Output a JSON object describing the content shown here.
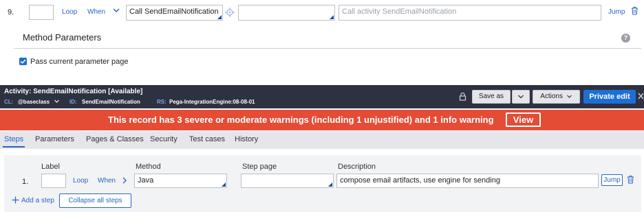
{
  "top_row": {
    "step_number": "9.",
    "loop_label": "Loop",
    "when_label": "When",
    "method_value": "Call SendEmailNotification",
    "step_page_value": "",
    "description_placeholder": "Call activity SendEmailNotification",
    "jump_label": "Jump"
  },
  "method_parameters": {
    "title": "Method Parameters",
    "pass_page_label": "Pass current parameter page",
    "pass_page_checked": true,
    "help_glyph": "?"
  },
  "header": {
    "title": "Activity: SendEmailNotification [Available]",
    "cl_label": "CL:",
    "cl_value": "@baseclass",
    "id_label": "ID:",
    "id_value": "SendEmailNotification",
    "rs_label": "RS:",
    "rs_value": "Pega-IntegrationEngine:08-08-01",
    "save_as_label": "Save as",
    "actions_label": "Actions",
    "private_edit_label": "Private edit"
  },
  "warning": {
    "text": "This record has 3 severe or moderate warnings (including 1 unjustified) and 1 info warning",
    "view_label": "View",
    "color": "#e54c35"
  },
  "tabs": [
    {
      "label": "Steps"
    },
    {
      "label": "Parameters"
    },
    {
      "label": "Pages & Classes"
    },
    {
      "label": "Security"
    },
    {
      "label": "Test cases"
    },
    {
      "label": "History"
    }
  ],
  "steps_table": {
    "headers": {
      "label": "Label",
      "method": "Method",
      "step_page": "Step page",
      "description": "Description"
    },
    "row": {
      "number": "1.",
      "label_value": "",
      "loop_label": "Loop",
      "when_label": "When",
      "method_value": "Java",
      "step_page_value": "",
      "description_value": "compose email artifacts, use engine for sending",
      "jump_label": "Jump"
    },
    "add_step_label": "Add a step",
    "collapse_label": "Collapse all steps"
  },
  "colors": {
    "accent": "#2a64c5",
    "dark_header": "#2d3140",
    "primary_button": "#1d6fd6"
  }
}
